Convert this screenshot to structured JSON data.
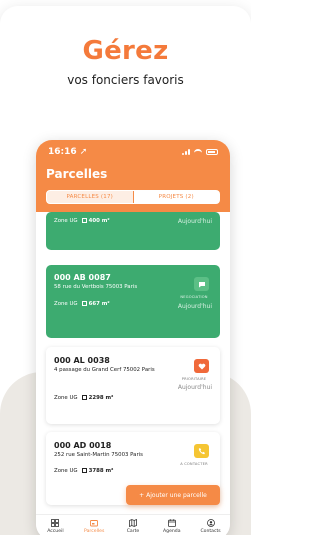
{
  "promo": {
    "headline": "Gérez",
    "subline": "vos fonciers favoris"
  },
  "status_bar": {
    "time": "16:16 ➚"
  },
  "screen": {
    "title": "Parcelles",
    "tabs": [
      {
        "label": "PARCELLES (17)",
        "active": true
      },
      {
        "label": "PROJETS (2)",
        "active": false
      }
    ]
  },
  "parcels": [
    {
      "id": "",
      "address": "",
      "zone": "Zone UG",
      "area": "400 m²",
      "status": "",
      "date": "Aujourd'hui",
      "style": "green",
      "badge_icon": "",
      "badge_color": ""
    },
    {
      "id": "000 AB 0087",
      "address": "58 rue du Vertbois 75003 Paris",
      "zone": "Zone UG",
      "area": "667 m²",
      "status": "NEGOCIATION",
      "date": "Aujourd'hui",
      "style": "green",
      "badge_icon": "chat-icon",
      "badge_color": "#5cbf86"
    },
    {
      "id": "000 AL 0038",
      "address": "4 passage du Grand Cerf 75002 Paris",
      "zone": "Zone UG",
      "area": "2298 m²",
      "status": "PRIORITAIRE",
      "date": "Aujourd'hui",
      "style": "white",
      "badge_icon": "heart-icon",
      "badge_color": "#f0693a"
    },
    {
      "id": "000 AD 0018",
      "address": "252 rue Saint-Martin 75003 Paris",
      "zone": "Zone UG",
      "area": "3788 m²",
      "status": "A CONTACTER",
      "date": "",
      "style": "white",
      "badge_icon": "phone-icon",
      "badge_color": "#f5c533"
    }
  ],
  "actions": {
    "add_parcel": "+ Ajouter une parcelle"
  },
  "tabbar": [
    {
      "label": "Accueil",
      "icon": "grid-icon",
      "active": false
    },
    {
      "label": "Parcelles",
      "icon": "folder-icon",
      "active": true
    },
    {
      "label": "Carte",
      "icon": "map-icon",
      "active": false
    },
    {
      "label": "Agenda",
      "icon": "calendar-icon",
      "active": false
    },
    {
      "label": "Contacts",
      "icon": "contacts-icon",
      "active": false
    }
  ],
  "colors": {
    "accent": "#f58a46",
    "headline": "#f47a3b",
    "green_card": "#3dab70"
  }
}
